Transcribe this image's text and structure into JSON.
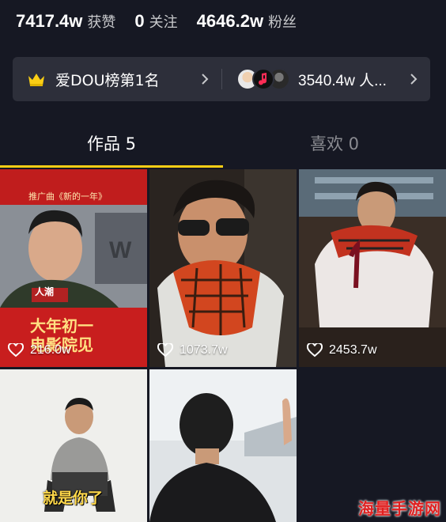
{
  "stats": [
    {
      "value": "7417.4w",
      "label": "获赞"
    },
    {
      "value": "0",
      "label": "关注"
    },
    {
      "value": "4646.2w",
      "label": "粉丝"
    }
  ],
  "rank_bar": {
    "rank_text": "爱DOU榜第1名",
    "fans_text": "3540.4w 人..."
  },
  "tabs": [
    {
      "label": "作品 5",
      "active": true
    },
    {
      "label": "喜欢 0",
      "active": false
    }
  ],
  "videos": [
    {
      "likes": "216.0w",
      "overlay_text": "大年初一\n电影院见",
      "top_text": "推广曲《新的一年》",
      "small_text": "人潮"
    },
    {
      "likes": "1073.7w"
    },
    {
      "likes": "2453.7w"
    },
    {
      "caption": "就是你了"
    },
    {}
  ],
  "watermark": "海量手游网",
  "colors": {
    "background": "#161823",
    "accent": "#face15",
    "card": "#2d2f3a"
  }
}
